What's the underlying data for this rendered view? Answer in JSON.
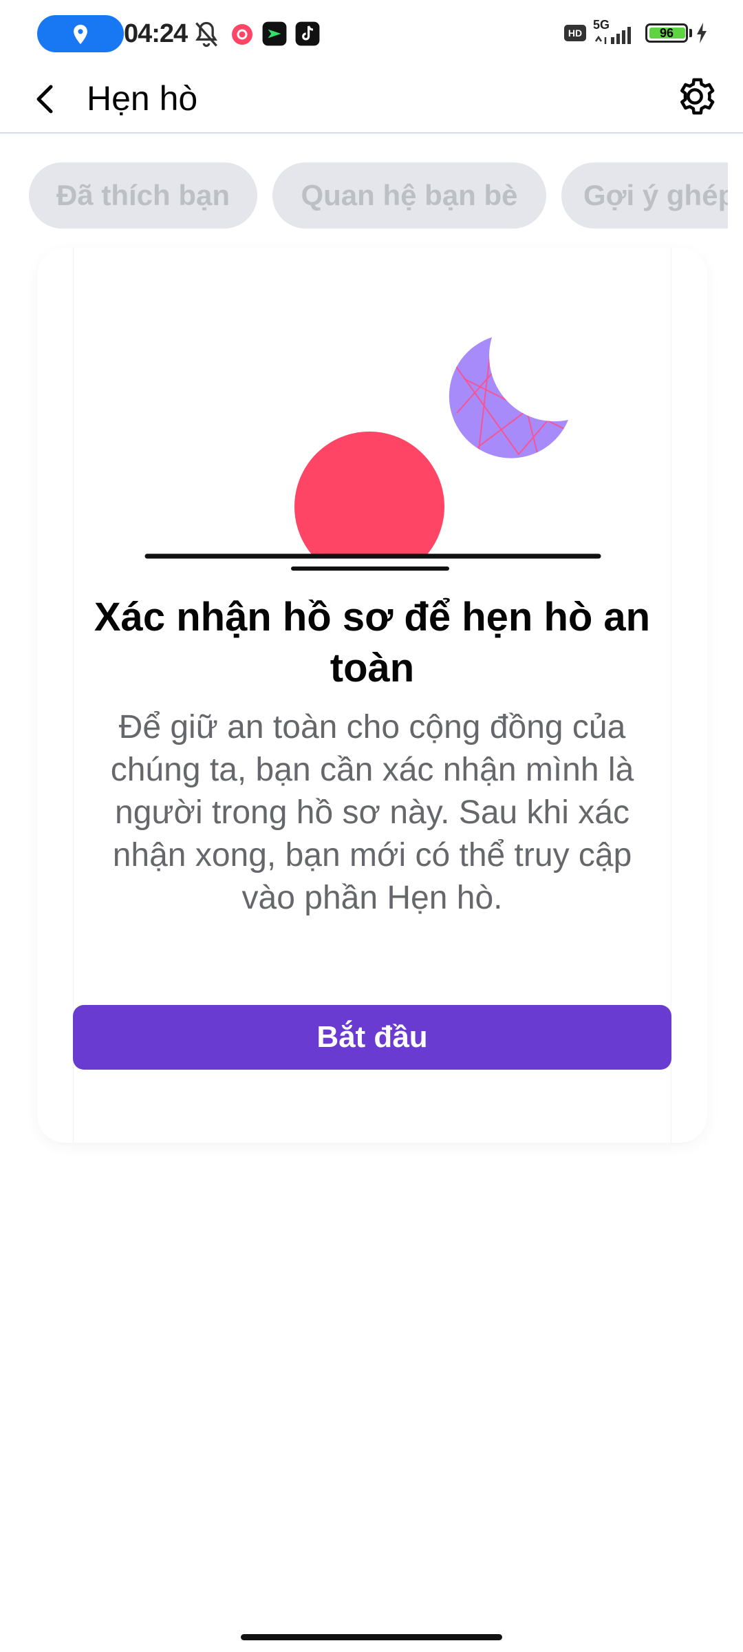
{
  "status_bar": {
    "time": "04:24",
    "network": "5G",
    "hd_label": "HD",
    "battery_level": "96",
    "icons": [
      "location-icon",
      "mute-icon",
      "app-notification-icon",
      "messenger-app-icon",
      "tiktok-icon",
      "signal-icon",
      "charging-icon"
    ]
  },
  "header": {
    "title": "Hẹn hò",
    "back_icon": "chevron-left-icon",
    "settings_icon": "gear-icon"
  },
  "chips": [
    {
      "label": "Đã thích bạn"
    },
    {
      "label": "Quan hệ bạn bè"
    },
    {
      "label": "Gợi ý ghép"
    }
  ],
  "card": {
    "title": "Xác nhận hồ sơ để hẹn hò an toàn",
    "body": "Để giữ an toàn cho cộng đồng của chúng ta, bạn cần xác nhận mình là người trong hồ sơ này. Sau khi xác nhận xong, bạn mới có thể truy cập vào phần Hẹn hò.",
    "button_label": "Bắt đầu"
  },
  "colors": {
    "accent": "#6a3bd1",
    "sun": "#ff4565",
    "moon": "#a78bfa",
    "chip_bg": "#e4e6eb",
    "chip_text": "#bcc0c4",
    "location_pill": "#1877f2",
    "battery": "#5fd443"
  }
}
